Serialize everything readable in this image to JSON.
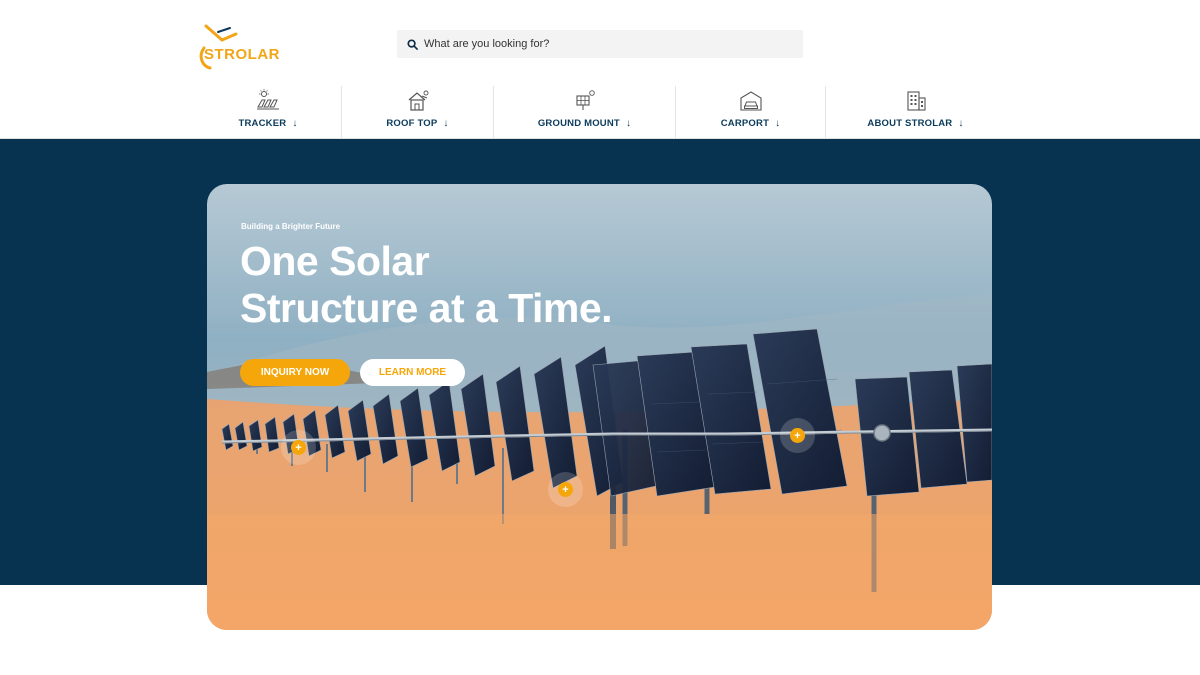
{
  "brand": {
    "name": "STROLAR",
    "accent": "#f5a60a",
    "navy": "#073350"
  },
  "search": {
    "placeholder": "What are you looking for?",
    "icon": "search-icon"
  },
  "nav": {
    "items": [
      {
        "label": "TRACKER",
        "icon": "solar-tracker-icon"
      },
      {
        "label": "ROOF TOP",
        "icon": "house-solar-icon"
      },
      {
        "label": "GROUND MOUNT",
        "icon": "ground-mount-icon"
      },
      {
        "label": "CARPORT",
        "icon": "carport-icon"
      },
      {
        "label": "ABOUT STROLAR",
        "icon": "building-icon"
      }
    ],
    "arrow": "↓"
  },
  "hero": {
    "kicker": "Building a Brighter Future",
    "headline_line1": "One Solar",
    "headline_line2": "Structure at a Time.",
    "primary_button": "INQUIRY NOW",
    "secondary_button": "LEARN MORE",
    "hotspot_symbol": "+"
  }
}
